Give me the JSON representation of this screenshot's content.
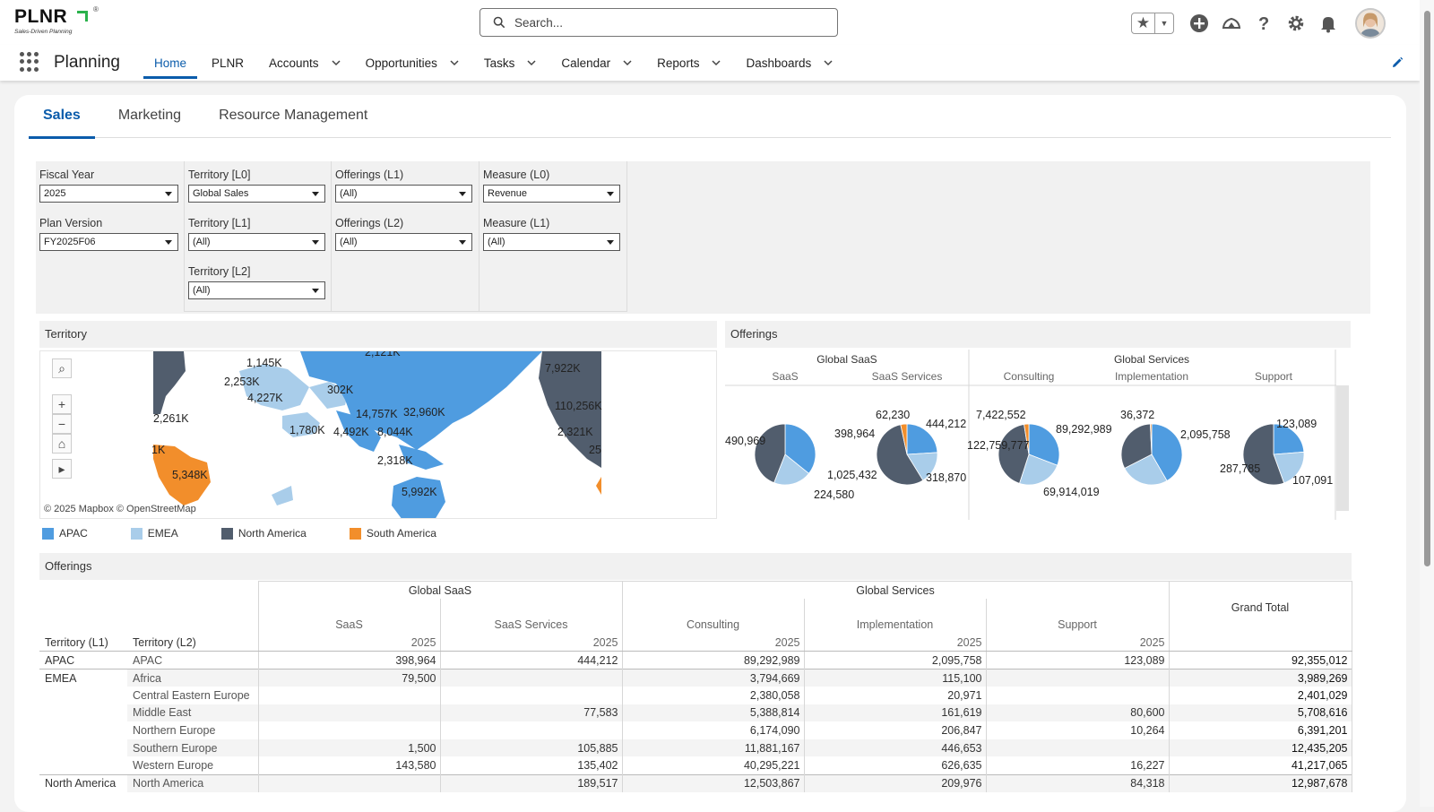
{
  "header": {
    "logo_text": "PLNR",
    "logo_registered": "®",
    "logo_tagline": "Sales-Driven Planning",
    "search_placeholder": "Search...",
    "icons": [
      "star-icon",
      "chevron-down-icon",
      "add-icon",
      "trailhead-icon",
      "help-icon",
      "gear-icon",
      "bell-icon",
      "avatar"
    ]
  },
  "nav": {
    "app_name": "Planning",
    "items": [
      {
        "label": "Home",
        "active": true,
        "dropdown": false
      },
      {
        "label": "PLNR",
        "active": false,
        "dropdown": false
      },
      {
        "label": "Accounts",
        "active": false,
        "dropdown": true
      },
      {
        "label": "Opportunities",
        "active": false,
        "dropdown": true
      },
      {
        "label": "Tasks",
        "active": false,
        "dropdown": true
      },
      {
        "label": "Calendar",
        "active": false,
        "dropdown": true
      },
      {
        "label": "Reports",
        "active": false,
        "dropdown": true
      },
      {
        "label": "Dashboards",
        "active": false,
        "dropdown": true
      }
    ]
  },
  "tabs": [
    {
      "label": "Sales",
      "active": true
    },
    {
      "label": "Marketing",
      "active": false
    },
    {
      "label": "Resource Management",
      "active": false
    }
  ],
  "filters": {
    "fiscal_year": {
      "label": "Fiscal Year",
      "value": "2025"
    },
    "plan_version": {
      "label": "Plan Version",
      "value": "FY2025F06"
    },
    "territory_l0": {
      "label": "Territory [L0]",
      "value": "Global Sales"
    },
    "territory_l1": {
      "label": "Territory [L1]",
      "value": "(All)"
    },
    "territory_l2": {
      "label": "Territory [L2]",
      "value": "(All)"
    },
    "offerings_l1": {
      "label": "Offerings (L1)",
      "value": "(All)"
    },
    "offerings_l2": {
      "label": "Offerings (L2)",
      "value": "(All)"
    },
    "measure_l0": {
      "label": "Measure (L0)",
      "value": "Revenue"
    },
    "measure_l1": {
      "label": "Measure (L1)",
      "value": "(All)"
    }
  },
  "territory_panel": {
    "title": "Territory",
    "attribution": "© 2025 Mapbox  © OpenStreetMap",
    "labels": [
      "1,145K",
      "2,121K",
      "2,253K",
      "4,227K",
      "302K",
      "7,922K",
      "2,261K",
      "14,757K",
      "32,960K",
      "110,256K",
      "1,780K",
      "4,492K",
      "8,044K",
      "2,321K",
      "1K",
      "25",
      "5,348K",
      "2,318K",
      "5,992K"
    ]
  },
  "legend": [
    {
      "label": "APAC",
      "color": "#4f9ce0"
    },
    {
      "label": "EMEA",
      "color": "#a9cdea"
    },
    {
      "label": "North America",
      "color": "#515d6d"
    },
    {
      "label": "South America",
      "color": "#f28e2b"
    }
  ],
  "offerings_panel": {
    "title": "Offerings",
    "groups": [
      "Global SaaS",
      "Global Services"
    ],
    "columns": [
      "SaaS",
      "SaaS Services",
      "Consulting",
      "Implementation",
      "Support"
    ]
  },
  "chart_data": {
    "type": "pie",
    "series_colors": {
      "APAC": "#4f9ce0",
      "EMEA": "#a9cdea",
      "North America": "#515d6d",
      "South America": "#f28e2b"
    },
    "pies": [
      {
        "category": "SaaS",
        "slices": [
          {
            "name": "APAC",
            "value": 398964
          },
          {
            "name": "EMEA",
            "value": 224580
          },
          {
            "name": "North America",
            "value": 490969
          }
        ],
        "labels": [
          "398,964",
          "224,580",
          "490,969"
        ]
      },
      {
        "category": "SaaS Services",
        "slices": [
          {
            "name": "APAC",
            "value": 444212
          },
          {
            "name": "EMEA",
            "value": 318870
          },
          {
            "name": "North America",
            "value": 1025432
          },
          {
            "name": "South America",
            "value": 62230
          }
        ],
        "labels": [
          "444,212",
          "318,870",
          "1,025,432",
          "62,230"
        ]
      },
      {
        "category": "Consulting",
        "slices": [
          {
            "name": "APAC",
            "value": 89292989
          },
          {
            "name": "EMEA",
            "value": 69914019
          },
          {
            "name": "North America",
            "value": 122759777
          },
          {
            "name": "South America",
            "value": 7422552
          }
        ],
        "labels": [
          "89,292,989",
          "69,914,019",
          "122,759,777",
          "7,422,552"
        ]
      },
      {
        "category": "Implementation",
        "slices": [
          {
            "name": "APAC",
            "value": 2095758
          },
          {
            "name": "EMEA",
            "value": 1300000
          },
          {
            "name": "North America",
            "value": 1600000
          },
          {
            "name": "South America",
            "value": 36372
          }
        ],
        "labels": [
          "2,095,758",
          "36,372"
        ]
      },
      {
        "category": "Support",
        "slices": [
          {
            "name": "APAC",
            "value": 123089
          },
          {
            "name": "EMEA",
            "value": 107091
          },
          {
            "name": "North America",
            "value": 287785
          }
        ],
        "labels": [
          "123,089",
          "107,091",
          "287,785"
        ]
      }
    ]
  },
  "table": {
    "title": "Offerings",
    "group_headers": [
      "Global SaaS",
      "Global Services"
    ],
    "grand_total_label": "Grand Total",
    "row_headers": [
      "Territory (L1)",
      "Territory (L2)"
    ],
    "columns": [
      "SaaS",
      "SaaS Services",
      "Consulting",
      "Implementation",
      "Support"
    ],
    "year": "2025",
    "rows": [
      {
        "l1": "APAC",
        "l2": "APAC",
        "v": [
          "398,964",
          "444,212",
          "89,292,989",
          "2,095,758",
          "123,089",
          "92,355,012"
        ]
      },
      {
        "l1": "EMEA",
        "l2": "Africa",
        "v": [
          "79,500",
          "",
          "3,794,669",
          "115,100",
          "",
          "3,989,269"
        ]
      },
      {
        "l1": "",
        "l2": "Central Eastern Europe",
        "v": [
          "",
          "",
          "2,380,058",
          "20,971",
          "",
          "2,401,029"
        ]
      },
      {
        "l1": "",
        "l2": "Middle East",
        "v": [
          "",
          "77,583",
          "5,388,814",
          "161,619",
          "80,600",
          "5,708,616"
        ]
      },
      {
        "l1": "",
        "l2": "Northern Europe",
        "v": [
          "",
          "",
          "6,174,090",
          "206,847",
          "10,264",
          "6,391,201"
        ]
      },
      {
        "l1": "",
        "l2": "Southern Europe",
        "v": [
          "1,500",
          "105,885",
          "11,881,167",
          "446,653",
          "",
          "12,435,205"
        ]
      },
      {
        "l1": "",
        "l2": "Western Europe",
        "v": [
          "143,580",
          "135,402",
          "40,295,221",
          "626,635",
          "16,227",
          "41,217,065"
        ]
      },
      {
        "l1": "North America",
        "l2": "North America",
        "v": [
          "",
          "189,517",
          "12,503,867",
          "209,976",
          "84,318",
          "12,987,678"
        ]
      }
    ]
  }
}
